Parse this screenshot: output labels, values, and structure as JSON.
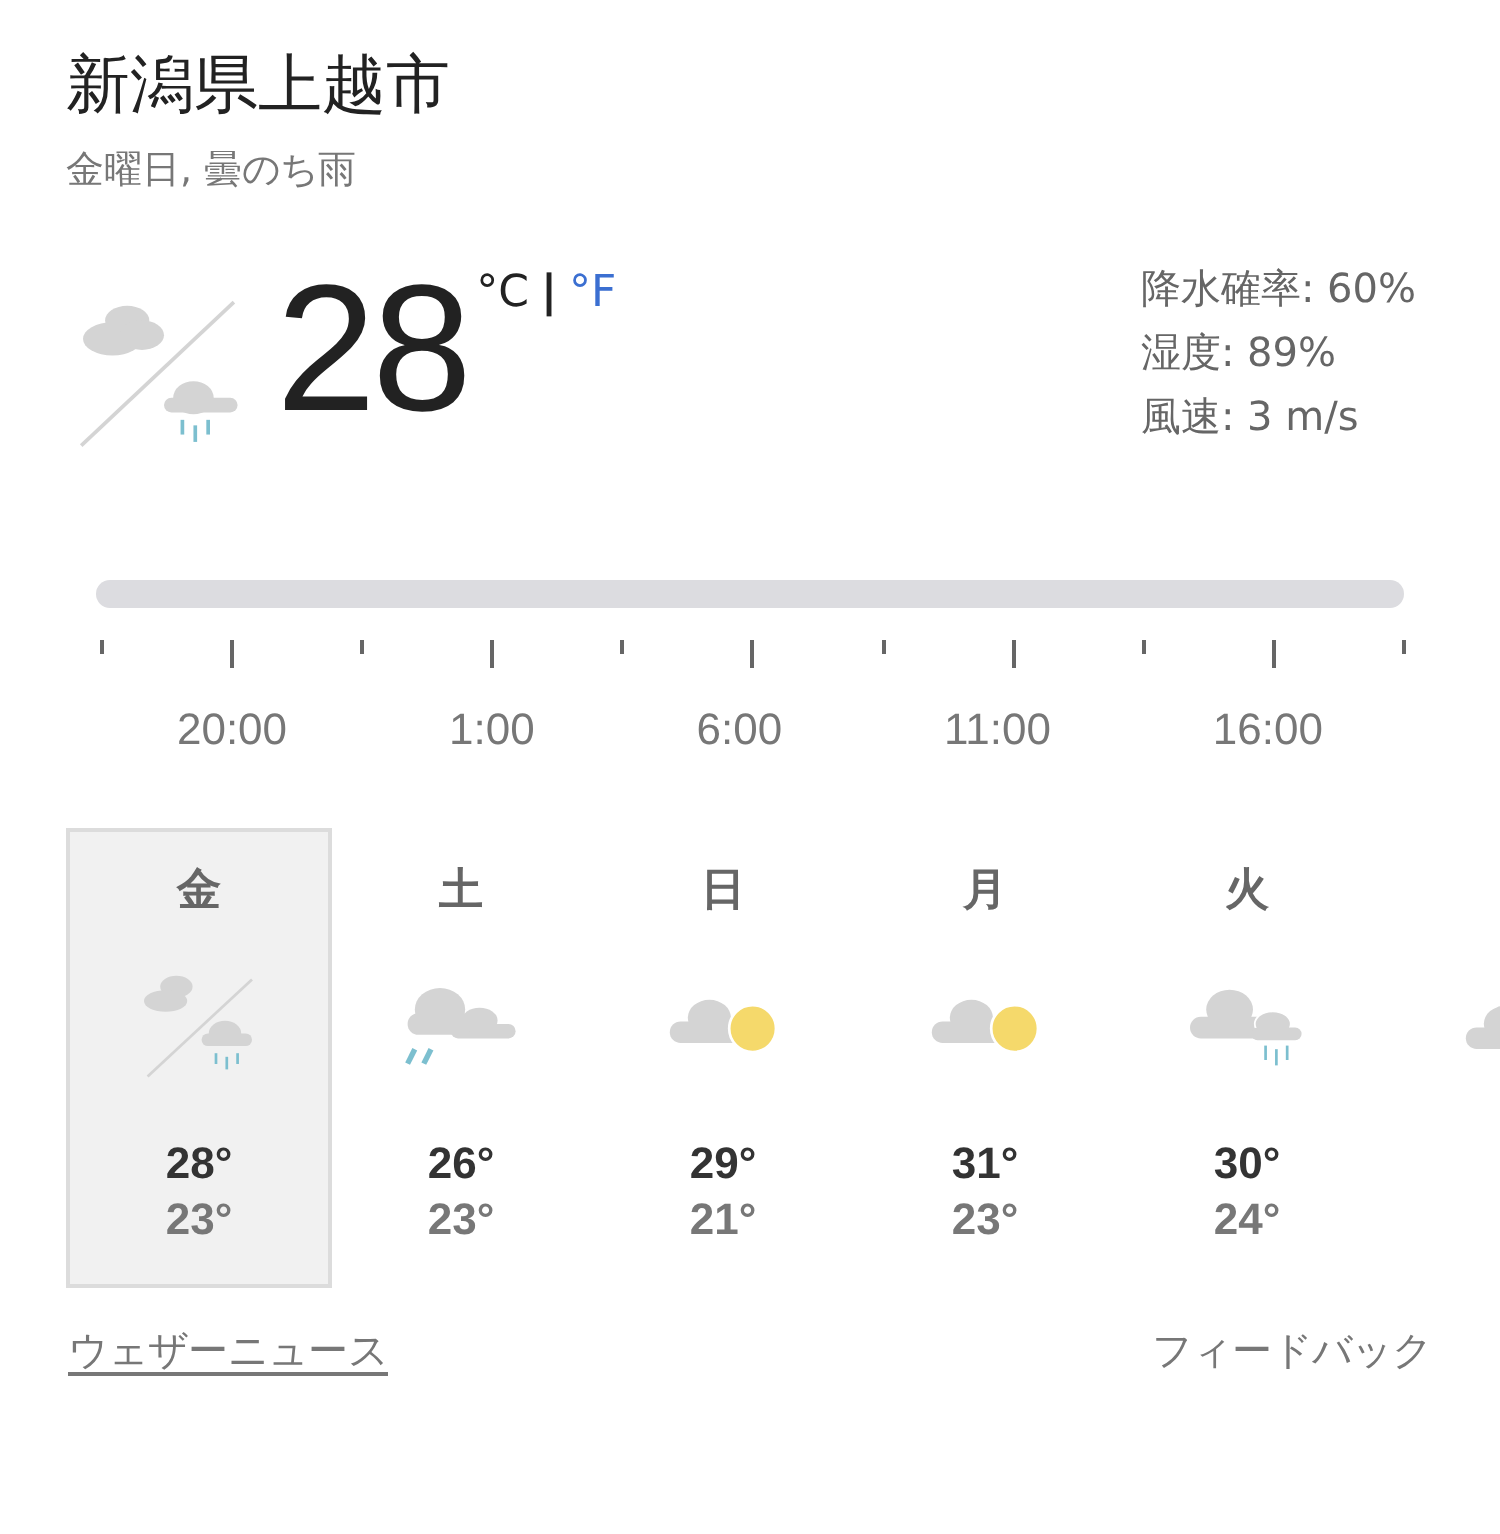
{
  "location": "新潟県上越市",
  "subtitle": "金曜日, 曇のち雨",
  "current": {
    "kind": "cloudy_then_rain",
    "temperature": "28",
    "units": [
      {
        "label": "°C",
        "selected": true
      },
      {
        "label": "°F",
        "selected": false
      }
    ],
    "separator": "|"
  },
  "details": [
    "降水確率: 60%",
    "湿度: 89%",
    "風速: 3 m/s"
  ],
  "timeline": {
    "times": [
      "20:00",
      "1:00",
      "6:00",
      "11:00",
      "16:00"
    ]
  },
  "days": [
    {
      "day": "金",
      "kind": "cloudy_then_rain",
      "high": "28°",
      "low": "23°",
      "selected": true
    },
    {
      "day": "土",
      "kind": "rain_cloudy",
      "high": "26°",
      "low": "23°",
      "selected": false
    },
    {
      "day": "日",
      "kind": "partly_sunny",
      "high": "29°",
      "low": "21°",
      "selected": false
    },
    {
      "day": "月",
      "kind": "partly_sunny",
      "high": "31°",
      "low": "23°",
      "selected": false
    },
    {
      "day": "火",
      "kind": "cloud_rain",
      "high": "30°",
      "low": "24°",
      "selected": false
    },
    {
      "kind": "cloudy",
      "selected": false
    }
  ],
  "links": {
    "news": "ウェザーニュース",
    "feedback": "フィードバック"
  }
}
